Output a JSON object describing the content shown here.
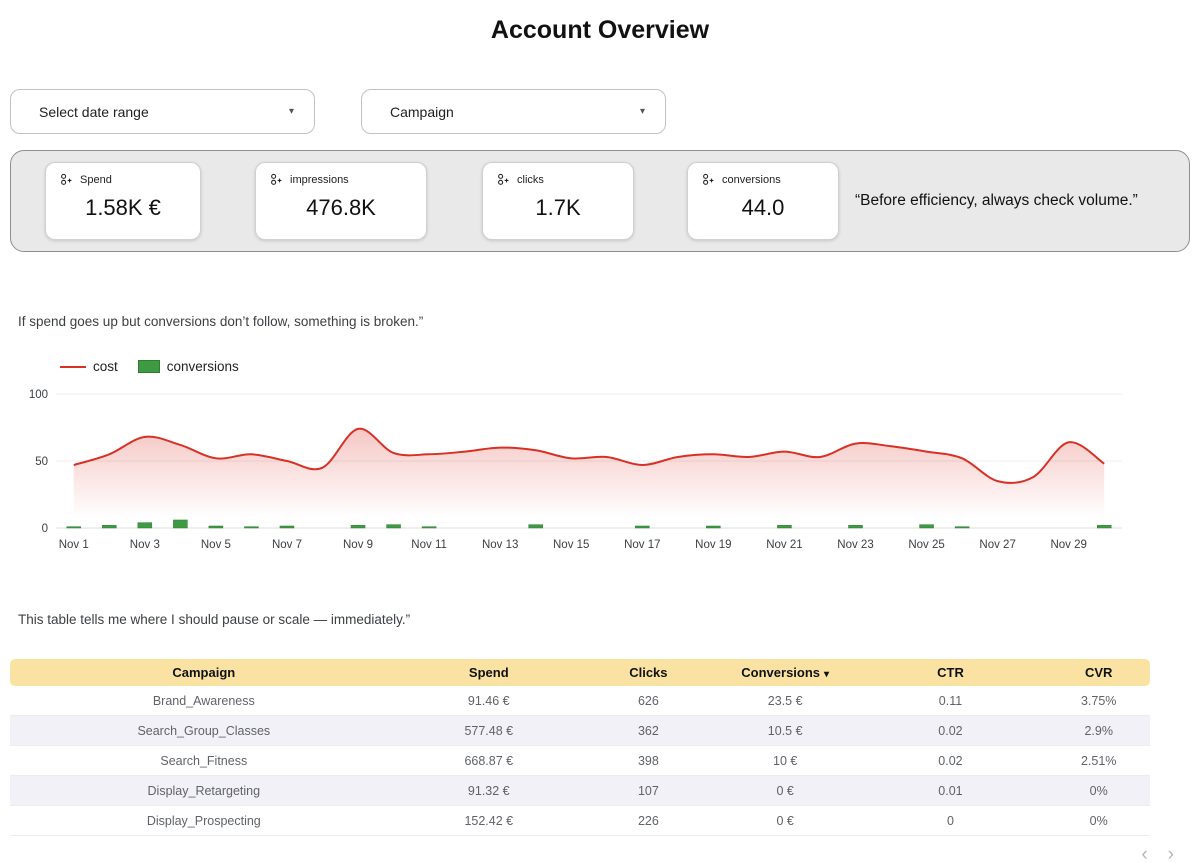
{
  "page": {
    "title": "Account Overview"
  },
  "icons": {
    "dropdown_caret": "▾",
    "sort_desc": "▾",
    "pagination_prev": "‹",
    "pagination_next": "›"
  },
  "filters": {
    "date_range_label": "Select date range",
    "campaign_label": "Campaign"
  },
  "kpis": [
    {
      "label": "Spend",
      "value": "1.58K €"
    },
    {
      "label": "impressions",
      "value": "476.8K"
    },
    {
      "label": "clicks",
      "value": "1.7K"
    },
    {
      "label": "conversions",
      "value": "44.0"
    }
  ],
  "quote": "“Before efficiency,  always check volume.”",
  "notes": {
    "chart": "If spend goes up but conversions don’t follow, something is broken.”",
    "table": "This table tells me where I should pause or scale — immediately.”"
  },
  "chart_data": {
    "type": "combo",
    "title": "",
    "xlabel": "",
    "ylabel": "",
    "ylim": [
      0,
      100
    ],
    "yticks": [
      0,
      50,
      100
    ],
    "grid": true,
    "legend_position": "top-left",
    "x": [
      "Nov 1",
      "Nov 2",
      "Nov 3",
      "Nov 4",
      "Nov 5",
      "Nov 6",
      "Nov 7",
      "Nov 8",
      "Nov 9",
      "Nov 10",
      "Nov 11",
      "Nov 12",
      "Nov 13",
      "Nov 14",
      "Nov 15",
      "Nov 16",
      "Nov 17",
      "Nov 18",
      "Nov 19",
      "Nov 20",
      "Nov 21",
      "Nov 22",
      "Nov 23",
      "Nov 24",
      "Nov 25",
      "Nov 26",
      "Nov 27",
      "Nov 28",
      "Nov 29",
      "Nov 30"
    ],
    "xtick_indices": [
      0,
      2,
      4,
      6,
      8,
      10,
      12,
      14,
      16,
      18,
      20,
      22,
      24,
      26,
      28
    ],
    "series": [
      {
        "name": "cost",
        "type": "line",
        "color": "#d93025",
        "values": [
          47,
          55,
          68,
          62,
          52,
          55,
          50,
          45,
          74,
          56,
          55,
          57,
          60,
          58,
          52,
          53,
          47,
          53,
          55,
          53,
          57,
          53,
          63,
          61,
          57,
          52,
          35,
          38,
          64,
          48
        ]
      },
      {
        "name": "conversions",
        "type": "bar",
        "color": "#3f9a44",
        "border": "#2e7d32",
        "values": [
          1,
          2,
          4,
          6,
          1.5,
          1,
          1.5,
          0,
          2,
          2.5,
          1,
          0,
          0,
          2.5,
          0,
          0,
          1.5,
          0,
          1.5,
          0,
          2,
          0,
          2,
          0,
          2.5,
          1,
          0,
          0,
          0,
          2
        ]
      }
    ]
  },
  "table": {
    "header_bg": "#fae3a2",
    "columns": [
      "Campaign",
      "Spend",
      "Clicks",
      "Conversions",
      "CTR",
      "CVR"
    ],
    "sort_column": "Conversions",
    "rows": [
      [
        "Brand_Awareness",
        "91.46 €",
        "626",
        "23.5 €",
        "0.11",
        "3.75%"
      ],
      [
        "Search_Group_Classes",
        "577.48 €",
        "362",
        "10.5 €",
        "0.02",
        "2.9%"
      ],
      [
        "Search_Fitness",
        "668.87 €",
        "398",
        "10 €",
        "0.02",
        "2.51%"
      ],
      [
        "Display_Retargeting",
        "91.32 €",
        "107",
        "0 €",
        "0.01",
        "0%"
      ],
      [
        "Display_Prospecting",
        "152.42 €",
        "226",
        "0 €",
        "0",
        "0%"
      ]
    ]
  }
}
